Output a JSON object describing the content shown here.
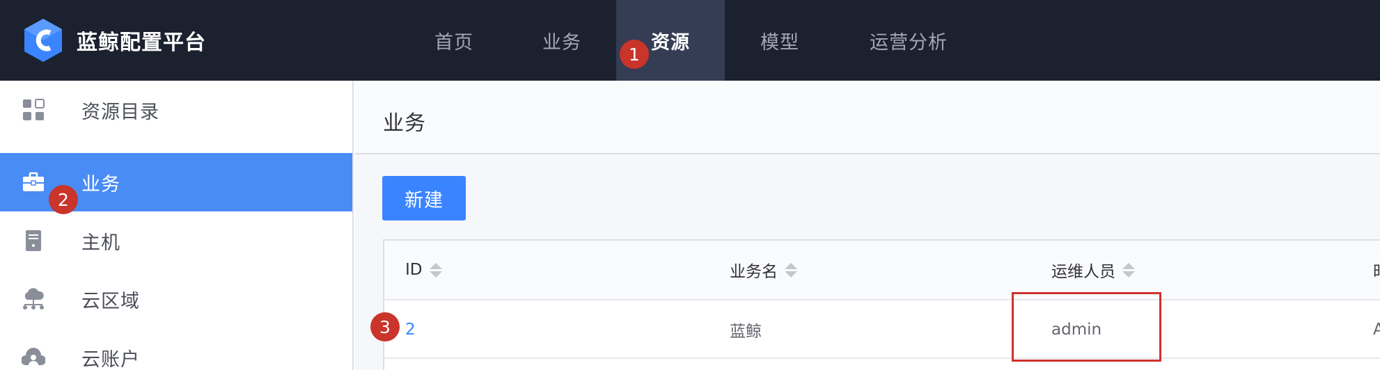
{
  "brand": {
    "name": "蓝鲸配置平台",
    "logo_icon": "bk-logo-icon",
    "color": "#3a84ff"
  },
  "nav": {
    "items": [
      {
        "label": "首页",
        "active": false
      },
      {
        "label": "业务",
        "active": false
      },
      {
        "label": "资源",
        "active": true
      },
      {
        "label": "模型",
        "active": false
      },
      {
        "label": "运营分析",
        "active": false
      }
    ]
  },
  "sidebar": {
    "items": [
      {
        "label": "资源目录",
        "icon": "grid-icon",
        "active": false
      },
      {
        "label": "业务",
        "icon": "briefcase-icon",
        "active": true
      },
      {
        "label": "主机",
        "icon": "server-icon",
        "active": false
      },
      {
        "label": "云区域",
        "icon": "cloud-network-icon",
        "active": false
      },
      {
        "label": "云账户",
        "icon": "cloud-account-icon",
        "active": false
      }
    ]
  },
  "main": {
    "title": "业务",
    "new_button": "新建",
    "table": {
      "columns": [
        "ID",
        "业务名",
        "运维人员",
        "时"
      ],
      "rows": [
        {
          "id": "2",
          "name": "蓝鲸",
          "maintainer": "admin",
          "extra": "A"
        }
      ]
    }
  },
  "annotations": {
    "badges": [
      "1",
      "2",
      "3"
    ],
    "badge_color": "#c9342b",
    "highlight_color": "#d0312d"
  },
  "colors": {
    "topbar": "#1c2130",
    "nav_active": "#353d54",
    "sidebar_active": "#4a8cf5",
    "primary": "#3a84ff"
  }
}
